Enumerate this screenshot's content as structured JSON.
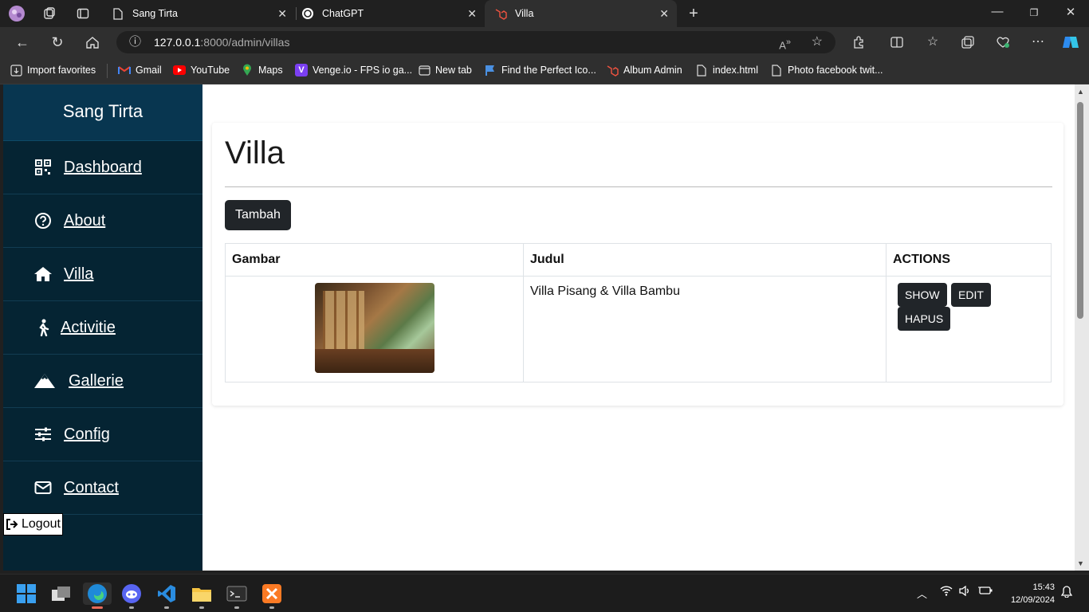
{
  "browser": {
    "tabs": [
      {
        "label": "Sang Tirta",
        "active": false
      },
      {
        "label": "ChatGPT",
        "active": false
      },
      {
        "label": "Villa",
        "active": true
      }
    ],
    "url_host": "127.0.0.1",
    "url_rest": ":8000/admin/villas",
    "bookmarks": [
      "Import favorites",
      "Gmail",
      "YouTube",
      "Maps",
      "Venge.io - FPS io ga...",
      "New tab",
      "Find the Perfect Ico...",
      "Album Admin",
      "index.html",
      "Photo facebook twit..."
    ]
  },
  "sidebar": {
    "brand": "Sang Tirta",
    "items": [
      {
        "label": "Dashboard",
        "icon": "qr-icon"
      },
      {
        "label": "About",
        "icon": "question-circle-icon"
      },
      {
        "label": "Villa",
        "icon": "home-icon"
      },
      {
        "label": "Activitie",
        "icon": "walking-icon"
      },
      {
        "label": "Gallerie",
        "icon": "mountain-icon"
      },
      {
        "label": "Config",
        "icon": "sliders-icon"
      },
      {
        "label": "Contact",
        "icon": "envelope-icon"
      }
    ],
    "logout": "Logout"
  },
  "main": {
    "title": "Villa",
    "add_button": "Tambah",
    "table": {
      "headers": [
        "Gambar",
        "Judul",
        "ACTIONS"
      ],
      "rows": [
        {
          "judul": "Villa Pisang & Villa Bambu",
          "actions": [
            "SHOW",
            "EDIT",
            "HAPUS"
          ]
        }
      ]
    }
  },
  "taskbar": {
    "time": "15:43",
    "date": "12/09/2024"
  },
  "colors": {
    "sidebar_bg": "#052433",
    "brand_bg": "#083650",
    "button_dark": "#212529"
  }
}
